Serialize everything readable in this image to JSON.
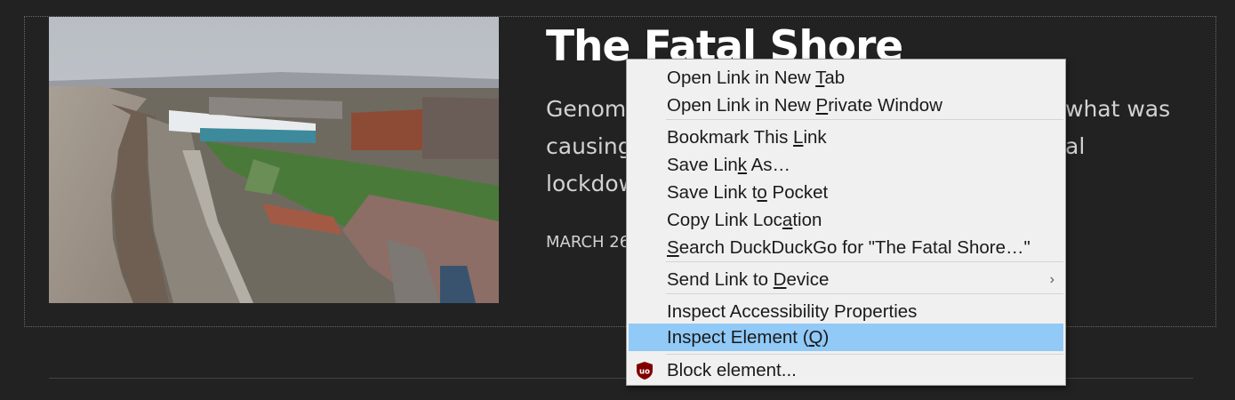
{
  "article": {
    "title": "The Fatal Shore",
    "excerpt_lines": [
      "Genomi",
      "causing",
      "lockdow"
    ],
    "excerpt_right": [
      "what was",
      "al"
    ],
    "date": "MARCH 26"
  },
  "context_menu": {
    "items": [
      {
        "id": "open-new-tab",
        "before": "Open Link in New ",
        "key": "T",
        "after": "ab"
      },
      {
        "id": "open-private",
        "before": "Open Link in New ",
        "key": "P",
        "after": "rivate Window"
      },
      {
        "id": "bookmark",
        "before": "Bookmark This ",
        "key": "L",
        "after": "ink"
      },
      {
        "id": "save-link-as",
        "before": "Save Lin",
        "key": "k",
        "after": " As…"
      },
      {
        "id": "save-to-pocket",
        "before": "Save Link t",
        "key": "o",
        "after": " Pocket"
      },
      {
        "id": "copy-link",
        "before": "Copy Link Loc",
        "key": "a",
        "after": "tion"
      },
      {
        "id": "search",
        "before": "",
        "key": "S",
        "after": "earch DuckDuckGo for \"The Fatal Shore…\""
      },
      {
        "id": "send-to-device",
        "before": "Send Link to ",
        "key": "D",
        "after": "evice"
      },
      {
        "id": "inspect-accessibility",
        "before": "Inspect Accessibility Properties",
        "key": "",
        "after": ""
      },
      {
        "id": "inspect-element",
        "before": "Inspect Element (",
        "key": "Q",
        "after": ")"
      },
      {
        "id": "block-element",
        "before": "Block element...",
        "key": "",
        "after": ""
      }
    ],
    "submenu_chevron": "›",
    "highlight_color": "#91c9f7",
    "ublock_badge": "uo"
  },
  "colors": {
    "background": "#222222",
    "title": "#ffffff",
    "body_text": "#d2d2d2",
    "menu_bg": "#f0f0f0",
    "ublock_red": "#800000"
  },
  "icons": {
    "ublock": "ublock-origin-shield-icon",
    "chevron": "chevron-right-icon"
  }
}
